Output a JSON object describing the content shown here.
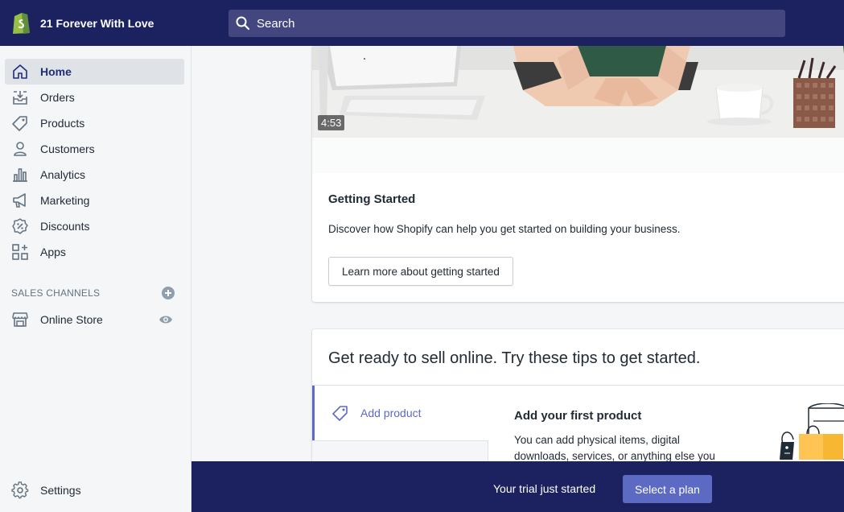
{
  "store": {
    "name": "21 Forever With Love"
  },
  "search": {
    "placeholder": "Search"
  },
  "sidebar": {
    "items": [
      {
        "label": "Home",
        "icon": "home-icon",
        "active": true
      },
      {
        "label": "Orders",
        "icon": "orders-icon"
      },
      {
        "label": "Products",
        "icon": "tag-icon"
      },
      {
        "label": "Customers",
        "icon": "person-icon"
      },
      {
        "label": "Analytics",
        "icon": "bar-chart-icon"
      },
      {
        "label": "Marketing",
        "icon": "megaphone-icon"
      },
      {
        "label": "Discounts",
        "icon": "discount-icon"
      },
      {
        "label": "Apps",
        "icon": "apps-icon"
      }
    ],
    "sales_channels_label": "SALES CHANNELS",
    "channels": [
      {
        "label": "Online Store",
        "icon": "store-icon"
      }
    ],
    "settings_label": "Settings"
  },
  "getting_started": {
    "video_duration": "4:53",
    "title": "Getting Started",
    "description": "Discover how Shopify can help you get started on building your business.",
    "button_label": "Learn more about getting started"
  },
  "tips": {
    "title": "Get ready to sell online. Try these tips to get started.",
    "tabs": [
      {
        "label": "Add product",
        "icon": "tag-icon"
      }
    ],
    "detail_title": "Add your first product",
    "detail_text": "You can add physical items, digital downloads, services, or anything else you"
  },
  "trial_bar": {
    "text": "Your trial just started",
    "button_label": "Select a plan"
  },
  "colors": {
    "topbar": "#1c2260",
    "accent": "#5c6ac4",
    "logo_green": "#95bf47"
  }
}
